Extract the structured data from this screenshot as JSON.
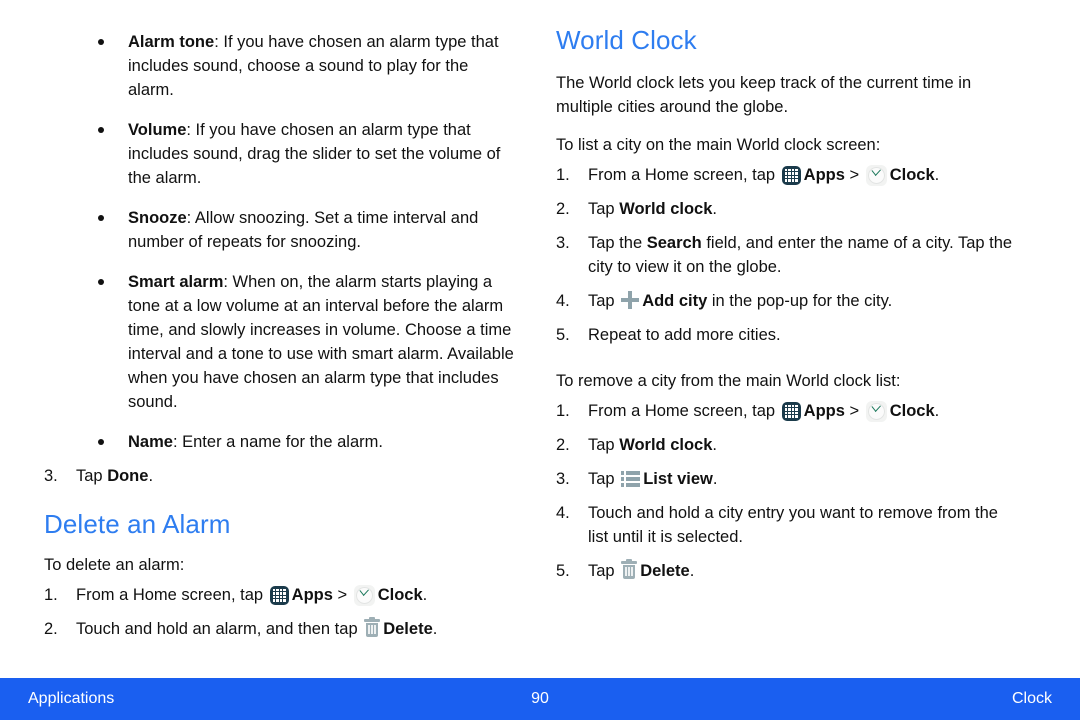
{
  "document": {
    "left_column": {
      "bullets": [
        {
          "term": "Alarm tone",
          "text": ": If you have chosen an alarm type that includes sound, choose a sound to play for the alarm."
        },
        {
          "term": "Volume",
          "text": ": If you have chosen an alarm type that includes sound, drag the slider to set the volume of the alarm."
        },
        {
          "term": "Snooze",
          "text": ": Allow snoozing. Set a time interval and number of repeats for snoozing."
        },
        {
          "term": "Smart alarm",
          "text": ": When on, the alarm starts playing a tone at a low volume at an interval before the alarm time, and slowly increases in volume. Choose a time interval and a tone to use with smart alarm. Available when you have chosen an alarm type that includes sound."
        },
        {
          "term": "Name",
          "text": ": Enter a name for the alarm."
        }
      ],
      "step3": {
        "num": "3.",
        "pre": "Tap ",
        "bold": "Done",
        "post": "."
      },
      "heading": "Delete an Alarm",
      "intro": "To delete an alarm:",
      "steps": [
        {
          "num": "1.",
          "pre": "From a Home screen, tap ",
          "apps_label": "Apps",
          "separator": " > ",
          "clock_label": "Clock",
          "post": "."
        },
        {
          "num": "2.",
          "pre": "Touch and hold an alarm, and then tap ",
          "delete_label": "Delete",
          "post": "."
        }
      ]
    },
    "right_column": {
      "heading": "World Clock",
      "intro": "The World clock lets you keep track of the current time in multiple cities around the globe.",
      "section_list": {
        "lead": "To list a city on the main World clock screen:",
        "steps": [
          {
            "num": "1.",
            "pre": "From a Home screen, tap ",
            "apps_label": "Apps",
            "separator": " > ",
            "clock_label": "Clock",
            "post": "."
          },
          {
            "num": "2.",
            "pre": "Tap ",
            "bold": "World clock",
            "post": "."
          },
          {
            "num": "3.",
            "pre": "Tap the ",
            "bold": "Search",
            "post": " field, and enter the name of a city. Tap the city to view it on the globe."
          },
          {
            "num": "4.",
            "pre": "Tap ",
            "bold": "Add city",
            "post": " in the pop-up for the city."
          },
          {
            "num": "5.",
            "plain": "Repeat to add more cities."
          }
        ]
      },
      "section_remove": {
        "lead": "To remove a city from the main World clock list:",
        "steps": [
          {
            "num": "1.",
            "pre": "From a Home screen, tap ",
            "apps_label": "Apps",
            "separator": " > ",
            "clock_label": "Clock",
            "post": "."
          },
          {
            "num": "2.",
            "pre": "Tap ",
            "bold": "World clock",
            "post": "."
          },
          {
            "num": "3.",
            "pre": "Tap ",
            "bold": "List view",
            "post": "."
          },
          {
            "num": "4.",
            "plain": "Touch and hold a city entry you want to remove from the list until it is selected."
          },
          {
            "num": "5.",
            "pre": "Tap ",
            "bold": "Delete",
            "post": "."
          }
        ]
      }
    },
    "footer": {
      "left": "Applications",
      "page_number": "90",
      "right": "Clock",
      "background_color": "#1A5FF0"
    },
    "theme": {
      "heading_color": "#2E7DF0",
      "text_color": "#111111",
      "apps_icon_color": "#1B3B4B",
      "icon_gray": "#8FA3AB"
    }
  }
}
